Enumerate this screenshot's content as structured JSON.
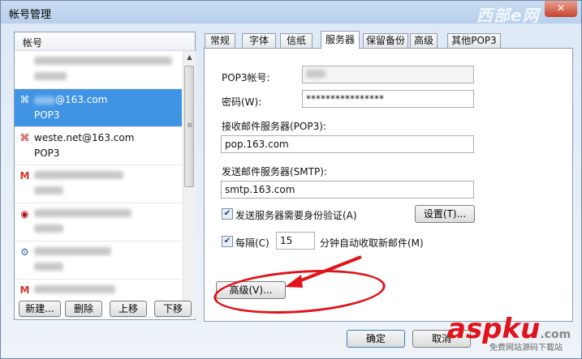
{
  "window": {
    "title": "帐号管理"
  },
  "left_pane": {
    "header": "帐号",
    "accounts": [
      {
        "icon": "blurred",
        "line1": "",
        "line2": ""
      },
      {
        "icon": "netease-icon",
        "line1": "@163.com",
        "line2": "POP3",
        "selected": true
      },
      {
        "icon": "netease-icon",
        "line1": "weste.net@163.com",
        "line2": "POP3"
      },
      {
        "icon": "gmail-icon",
        "line1": "",
        "line2": ""
      },
      {
        "icon": "red-mail-icon",
        "line1": "",
        "line2": ""
      },
      {
        "icon": "settings-mail-icon",
        "line1": "",
        "line2": ""
      },
      {
        "icon": "gmail-icon",
        "line1": "",
        "line2": ""
      }
    ],
    "buttons": {
      "new": "新建...",
      "delete": "删除",
      "up": "上移",
      "down": "下移"
    }
  },
  "tabs": [
    "常规",
    "字体",
    "信纸",
    "服务器",
    "保留备份",
    "高级",
    "其他POP3"
  ],
  "active_tab": "服务器",
  "server": {
    "pop3_account_label": "POP3帐号:",
    "password_label": "密码(W):",
    "password_value": "****************",
    "incoming_label": "接收邮件服务器(POP3):",
    "incoming_value": "pop.163.com",
    "outgoing_label": "发送邮件服务器(SMTP):",
    "outgoing_value": "smtp.163.com",
    "auth_label": "发送服务器需要身份验证(A)",
    "auth_checked": true,
    "settings_button": "设置(T)...",
    "every_label": "每隔(C)",
    "every_checked": true,
    "interval_value": "15",
    "interval_suffix": "分钟自动收取新邮件(M)",
    "advanced_button": "高级(V)..."
  },
  "footer": {
    "ok": "确定",
    "cancel": "取消"
  },
  "watermark": {
    "top": "西部e网",
    "brand": "aspku",
    "brand_suffix": ".com",
    "tagline": "免费网站源码下载站"
  },
  "colors": {
    "selection": "#3f94e4",
    "annotation": "#e0141a"
  }
}
